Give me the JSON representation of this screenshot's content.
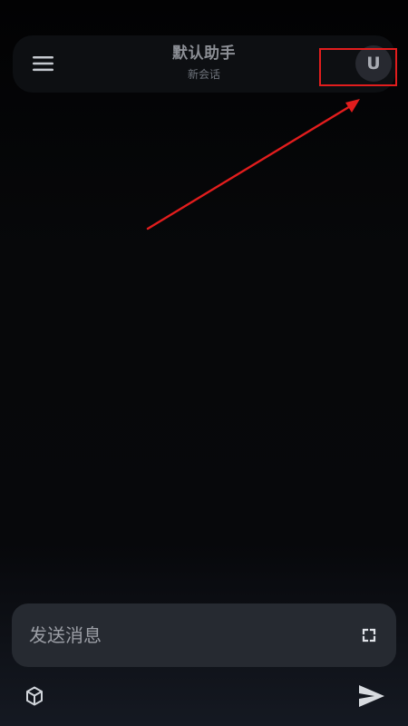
{
  "header": {
    "title": "默认助手",
    "subtitle": "新会话",
    "avatar_letter": "U"
  },
  "composer": {
    "placeholder": "发送消息"
  },
  "icons": {
    "menu": "menu-icon",
    "avatar": "user-avatar",
    "expand": "expand-icon",
    "model": "cube-icon",
    "send": "send-icon"
  },
  "colors": {
    "background": "#07080a",
    "header_background": "#0d0f12",
    "input_background": "#262a31",
    "text_primary": "#8c8f95",
    "text_secondary": "#6e737b",
    "icon": "#c8ccd2",
    "annotation": "#e21d1d"
  }
}
